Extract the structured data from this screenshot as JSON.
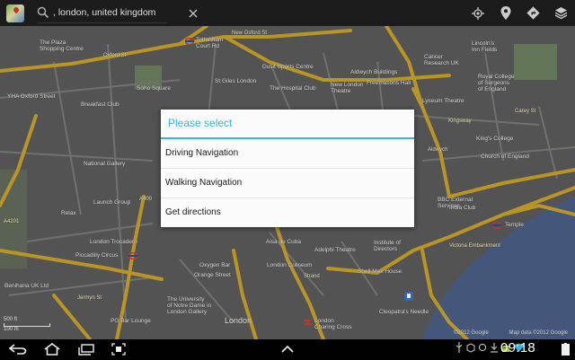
{
  "search": {
    "query": ", london, united kingdom"
  },
  "dialog": {
    "title": "Please select",
    "options": [
      "Driving Navigation",
      "Walking Navigation",
      "Get directions"
    ]
  },
  "map": {
    "labels": {
      "plaza": "The Plaza\nShopping Centre",
      "oxford_st": "Oxford St",
      "tottenham": "Tottenham\nCourt Rd",
      "new_oxford_st": "New Oxford St",
      "dusit": "Dusit Sports Centre",
      "aldwych_b": "Aldwych Buildings",
      "cancer": "Cancer\nResearch UK",
      "lincolns": "Lincoln's\nInn Fields",
      "soho": "Soho Square",
      "st_giles": "St Giles London",
      "hospital_club": "The Hospital Club",
      "new_london": "New London\nTheatre",
      "freemasons": "Freemasons Hall",
      "royal_college": "Royal College\nof Surgeons\nof England",
      "yha": "YHA Oxford Street",
      "breakfast": "Breakfast Club",
      "shaftesbury": "Shaftesbury",
      "kings_college": "King's College",
      "aldwych": "Aldwych",
      "church": "Church of England",
      "national_gallery": "National Gallery",
      "launch_group": "Launch Group",
      "london_trocadero": "London Trocadero",
      "piccadilly": "Piccadilly Circus",
      "bbc": "BBC External\nServices",
      "india_club": "India Club",
      "temple": "Temple",
      "embankment": "Victoria Embankment",
      "strand": "Strand",
      "imperial": "The Imperial",
      "aisa": "Aisa de Cuba",
      "adelphi": "Adelphi Theatre",
      "institute": "Institute of\nDirectors",
      "oxygen": "Oxygen Bar",
      "orange": "Orange Street",
      "london_coliseum": "London Coliseum",
      "shell_mex": "Shell Mex House",
      "benihana": "Benihana UK Ltd",
      "univ_gallery": "The University\nof Notre Dame in\nLondon Gallery",
      "pg_bar": "PG Bar Lounge",
      "london": "London",
      "charing_cross": "London\nCharing Cross",
      "cleopatra": "Cleopatra's Needle",
      "jermyn": "Jermyn St",
      "a400": "A400",
      "a4201": "A4201",
      "relax": "Relax",
      "national_portrait": "National Portrait Gallery",
      "lyceum": "Lyceum Theatre",
      "savoy": "Savoy Theatre",
      "east_st": "East St",
      "carey": "Carey St",
      "kingsway": "Kingsway"
    },
    "scale": "500 ft",
    "scale_m": "100 m",
    "copyright": "©2012 Google",
    "map_data": "Map data ©2012 Google"
  },
  "status": {
    "time": "09:18"
  },
  "colors": {
    "accent": "#33b5e5",
    "map_bg": "#5b5b5b",
    "road": "#c9a22a",
    "water": "#4a5f86",
    "park": "#6b7f5e"
  }
}
